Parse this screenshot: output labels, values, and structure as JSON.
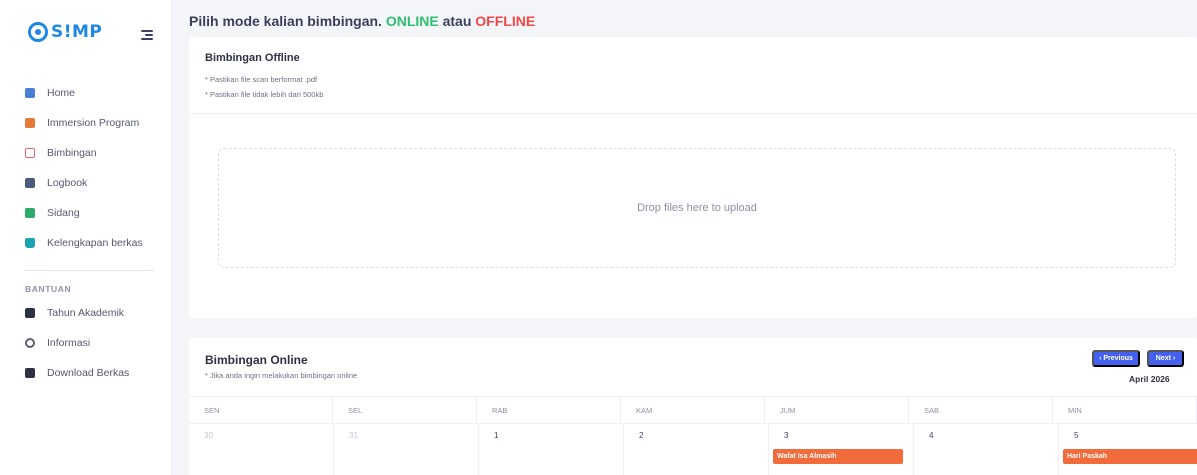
{
  "sidebar": {
    "logo_text": "S!MP",
    "items": [
      {
        "label": "Home",
        "icon": "home-icon"
      },
      {
        "label": "Immersion Program",
        "icon": "briefcase-icon"
      },
      {
        "label": "Bimbingan",
        "icon": "calendar-icon"
      },
      {
        "label": "Logbook",
        "icon": "book-icon"
      },
      {
        "label": "Sidang",
        "icon": "calendar-check-icon"
      },
      {
        "label": "Kelengkapan berkas",
        "icon": "lock-icon"
      }
    ],
    "section_label": "BANTUAN",
    "help_items": [
      {
        "label": "Tahun Akademik",
        "icon": "calendar-dark-icon"
      },
      {
        "label": "Informasi",
        "icon": "info-icon"
      },
      {
        "label": "Download Berkas",
        "icon": "download-icon"
      }
    ]
  },
  "page": {
    "title_prefix": "Pilih mode kalian bimbingan.",
    "title_online": "ONLINE",
    "title_mid": "atau",
    "title_offline": "OFFLINE"
  },
  "offline": {
    "title": "Bimbingan Offline",
    "note1": "* Pastikan file scan berformat .pdf",
    "note2": "* Pastikan file tidak lebih dari 500kb",
    "dropzone_text": "Drop files here to upload"
  },
  "online": {
    "title": "Bimbingan Online",
    "note": "* Jika anda ingin melakukan bimbingan online",
    "prev_label": "‹ Previous",
    "next_label": "Next ›",
    "month": "April 2026",
    "days": [
      "SEN",
      "SEL",
      "RAB",
      "KAM",
      "JUM",
      "SAB",
      "MIN"
    ],
    "dates": [
      "30",
      "31",
      "1",
      "2",
      "3",
      "4",
      "5"
    ],
    "events": {
      "fri": "Wafat Isa Almasih",
      "sun": "Hari Paskah"
    }
  },
  "colors": {
    "primary": "#4361ee",
    "online": "#2fbf71",
    "offline": "#f04848",
    "event": "#f26b3a"
  }
}
